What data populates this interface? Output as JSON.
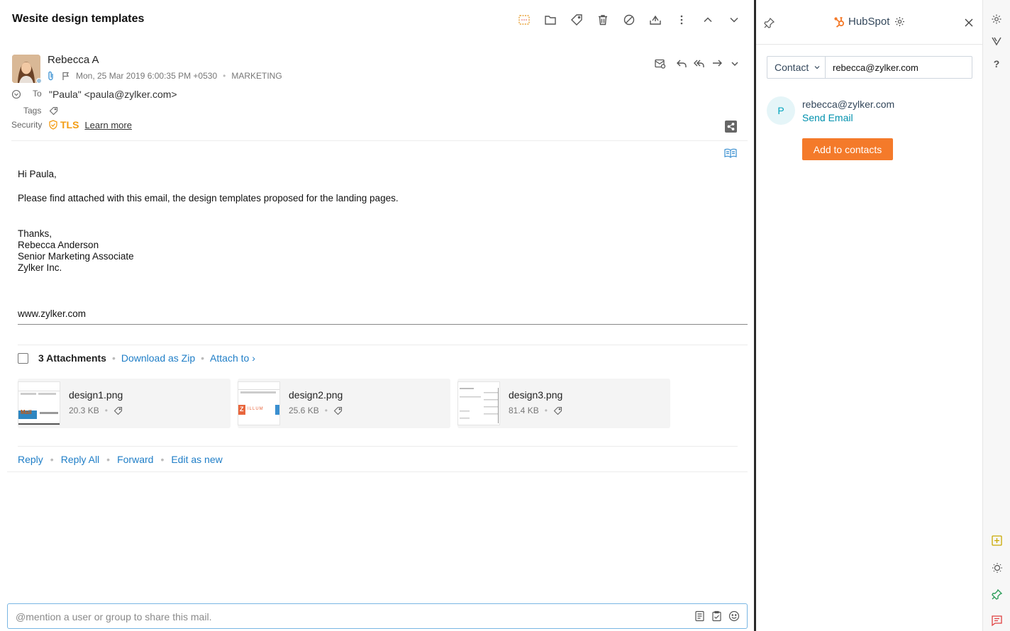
{
  "mail": {
    "subject": "Wesite design templates",
    "sender": {
      "name": "Rebecca A",
      "date": "Mon, 25 Mar 2019 6:00:35 PM +0530",
      "folder": "MARKETING"
    },
    "to_label": "To",
    "to_value": "\"Paula\" <paula@zylker.com>",
    "tags_label": "Tags",
    "security_label": "Security",
    "security_value": "TLS",
    "learn_more": "Learn more",
    "body": {
      "greeting": "Hi Paula,",
      "message": "Please find attached with this email, the design templates proposed for the landing pages.",
      "signature": [
        "Thanks,",
        "Rebecca Anderson",
        "Senior Marketing Associate",
        "Zylker Inc."
      ],
      "website": "www.zylker.com"
    },
    "attachments": {
      "count_label": "3 Attachments",
      "download_zip": "Download as Zip",
      "attach_to": "Attach to ›",
      "items": [
        {
          "name": "design1.png",
          "size": "20.3 KB"
        },
        {
          "name": "design2.png",
          "size": "25.6 KB"
        },
        {
          "name": "design3.png",
          "size": "81.4 KB"
        }
      ]
    },
    "actions": {
      "reply": "Reply",
      "reply_all": "Reply All",
      "forward": "Forward",
      "edit_as_new": "Edit as new"
    },
    "mention_placeholder": "@mention a user or group to share this mail.",
    "thumb_text": {
      "zillum_letter": "Z",
      "zillum_word": "ILLUM",
      "mail_word": "Mail"
    }
  },
  "hubspot": {
    "title": "HubSpot",
    "record_type": "Contact",
    "search_value": "rebecca@zylker.com",
    "avatar_initial": "P",
    "contact_email": "rebecca@zylker.com",
    "send_email": "Send Email",
    "add_button": "Add to contacts"
  },
  "rail": {
    "help": "?"
  },
  "colors": {
    "accent_link": "#1f7ec7",
    "hubspot_orange": "#f47a2a",
    "hubspot_teal": "#0091ae",
    "tls_orange": "#f39c12"
  }
}
